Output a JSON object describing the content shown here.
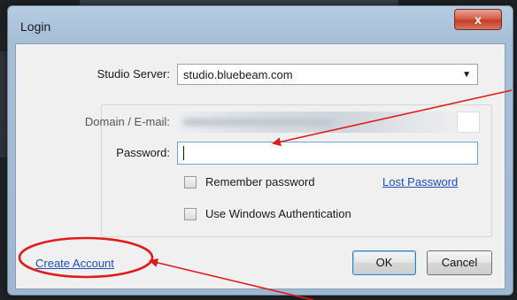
{
  "window": {
    "title": "Login",
    "close_symbol": "x"
  },
  "form": {
    "studio_server_label": "Studio Server:",
    "studio_server_value": "studio.bluebeam.com",
    "domain_label": "Domain / E-mail:",
    "password_label": "Password:",
    "remember_label": "Remember password",
    "lost_password_label": "Lost Password",
    "windows_auth_label": "Use Windows Authentication"
  },
  "footer": {
    "create_account_label": "Create  Account",
    "ok_label": "OK",
    "cancel_label": "Cancel"
  },
  "annotations": {
    "color": "#e01b1b"
  },
  "colors": {
    "link": "#1b4fc4",
    "close_button": "#c43c24",
    "focus_border": "#6ea4d6"
  }
}
